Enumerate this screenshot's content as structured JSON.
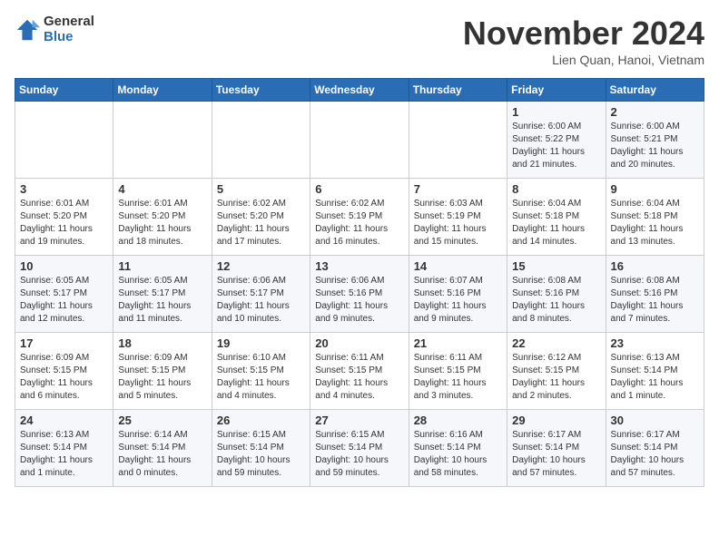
{
  "header": {
    "logo_general": "General",
    "logo_blue": "Blue",
    "month_title": "November 2024",
    "location": "Lien Quan, Hanoi, Vietnam"
  },
  "weekdays": [
    "Sunday",
    "Monday",
    "Tuesday",
    "Wednesday",
    "Thursday",
    "Friday",
    "Saturday"
  ],
  "weeks": [
    [
      {
        "day": "",
        "info": ""
      },
      {
        "day": "",
        "info": ""
      },
      {
        "day": "",
        "info": ""
      },
      {
        "day": "",
        "info": ""
      },
      {
        "day": "",
        "info": ""
      },
      {
        "day": "1",
        "info": "Sunrise: 6:00 AM\nSunset: 5:22 PM\nDaylight: 11 hours\nand 21 minutes."
      },
      {
        "day": "2",
        "info": "Sunrise: 6:00 AM\nSunset: 5:21 PM\nDaylight: 11 hours\nand 20 minutes."
      }
    ],
    [
      {
        "day": "3",
        "info": "Sunrise: 6:01 AM\nSunset: 5:20 PM\nDaylight: 11 hours\nand 19 minutes."
      },
      {
        "day": "4",
        "info": "Sunrise: 6:01 AM\nSunset: 5:20 PM\nDaylight: 11 hours\nand 18 minutes."
      },
      {
        "day": "5",
        "info": "Sunrise: 6:02 AM\nSunset: 5:20 PM\nDaylight: 11 hours\nand 17 minutes."
      },
      {
        "day": "6",
        "info": "Sunrise: 6:02 AM\nSunset: 5:19 PM\nDaylight: 11 hours\nand 16 minutes."
      },
      {
        "day": "7",
        "info": "Sunrise: 6:03 AM\nSunset: 5:19 PM\nDaylight: 11 hours\nand 15 minutes."
      },
      {
        "day": "8",
        "info": "Sunrise: 6:04 AM\nSunset: 5:18 PM\nDaylight: 11 hours\nand 14 minutes."
      },
      {
        "day": "9",
        "info": "Sunrise: 6:04 AM\nSunset: 5:18 PM\nDaylight: 11 hours\nand 13 minutes."
      }
    ],
    [
      {
        "day": "10",
        "info": "Sunrise: 6:05 AM\nSunset: 5:17 PM\nDaylight: 11 hours\nand 12 minutes."
      },
      {
        "day": "11",
        "info": "Sunrise: 6:05 AM\nSunset: 5:17 PM\nDaylight: 11 hours\nand 11 minutes."
      },
      {
        "day": "12",
        "info": "Sunrise: 6:06 AM\nSunset: 5:17 PM\nDaylight: 11 hours\nand 10 minutes."
      },
      {
        "day": "13",
        "info": "Sunrise: 6:06 AM\nSunset: 5:16 PM\nDaylight: 11 hours\nand 9 minutes."
      },
      {
        "day": "14",
        "info": "Sunrise: 6:07 AM\nSunset: 5:16 PM\nDaylight: 11 hours\nand 9 minutes."
      },
      {
        "day": "15",
        "info": "Sunrise: 6:08 AM\nSunset: 5:16 PM\nDaylight: 11 hours\nand 8 minutes."
      },
      {
        "day": "16",
        "info": "Sunrise: 6:08 AM\nSunset: 5:16 PM\nDaylight: 11 hours\nand 7 minutes."
      }
    ],
    [
      {
        "day": "17",
        "info": "Sunrise: 6:09 AM\nSunset: 5:15 PM\nDaylight: 11 hours\nand 6 minutes."
      },
      {
        "day": "18",
        "info": "Sunrise: 6:09 AM\nSunset: 5:15 PM\nDaylight: 11 hours\nand 5 minutes."
      },
      {
        "day": "19",
        "info": "Sunrise: 6:10 AM\nSunset: 5:15 PM\nDaylight: 11 hours\nand 4 minutes."
      },
      {
        "day": "20",
        "info": "Sunrise: 6:11 AM\nSunset: 5:15 PM\nDaylight: 11 hours\nand 4 minutes."
      },
      {
        "day": "21",
        "info": "Sunrise: 6:11 AM\nSunset: 5:15 PM\nDaylight: 11 hours\nand 3 minutes."
      },
      {
        "day": "22",
        "info": "Sunrise: 6:12 AM\nSunset: 5:15 PM\nDaylight: 11 hours\nand 2 minutes."
      },
      {
        "day": "23",
        "info": "Sunrise: 6:13 AM\nSunset: 5:14 PM\nDaylight: 11 hours\nand 1 minute."
      }
    ],
    [
      {
        "day": "24",
        "info": "Sunrise: 6:13 AM\nSunset: 5:14 PM\nDaylight: 11 hours\nand 1 minute."
      },
      {
        "day": "25",
        "info": "Sunrise: 6:14 AM\nSunset: 5:14 PM\nDaylight: 11 hours\nand 0 minutes."
      },
      {
        "day": "26",
        "info": "Sunrise: 6:15 AM\nSunset: 5:14 PM\nDaylight: 10 hours\nand 59 minutes."
      },
      {
        "day": "27",
        "info": "Sunrise: 6:15 AM\nSunset: 5:14 PM\nDaylight: 10 hours\nand 59 minutes."
      },
      {
        "day": "28",
        "info": "Sunrise: 6:16 AM\nSunset: 5:14 PM\nDaylight: 10 hours\nand 58 minutes."
      },
      {
        "day": "29",
        "info": "Sunrise: 6:17 AM\nSunset: 5:14 PM\nDaylight: 10 hours\nand 57 minutes."
      },
      {
        "day": "30",
        "info": "Sunrise: 6:17 AM\nSunset: 5:14 PM\nDaylight: 10 hours\nand 57 minutes."
      }
    ]
  ]
}
